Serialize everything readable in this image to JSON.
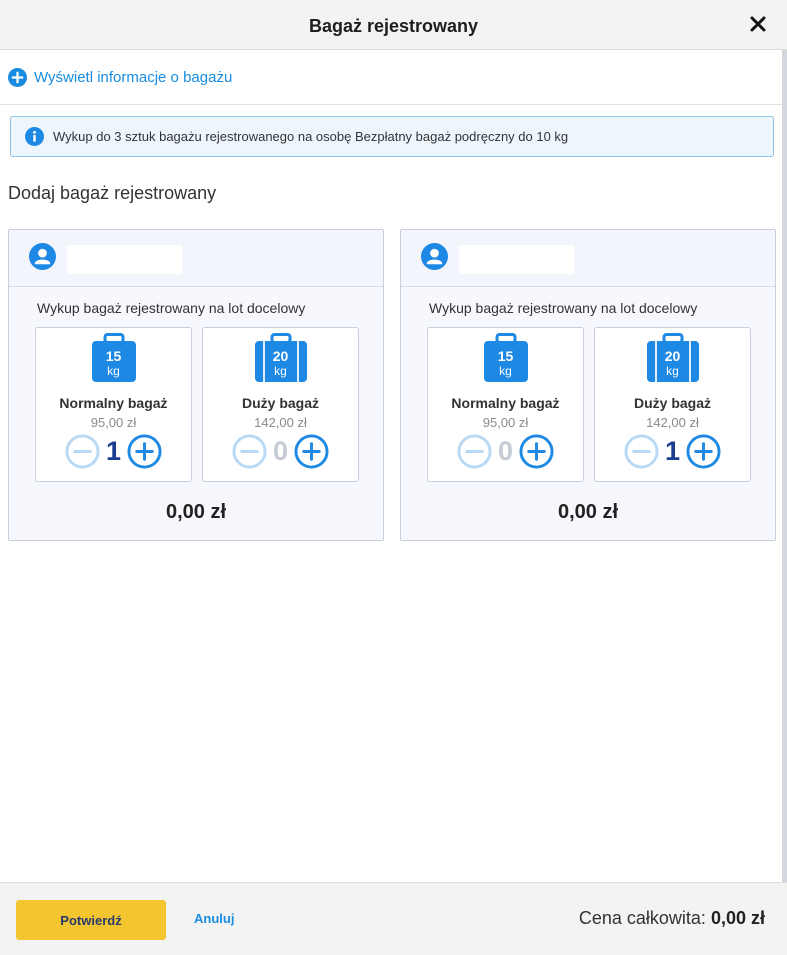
{
  "header": {
    "title": "Bagaż rejestrowany"
  },
  "info_link": {
    "label": "Wyświetl informacje o bagażu"
  },
  "notice": {
    "text": "Wykup do 3 sztuk bagażu rejestrowanego na osobę Bezpłatny bagaż podręczny do 10 kg"
  },
  "section_title": "Dodaj bagaż rejestrowany",
  "passengers": [
    {
      "subtitle": "Wykup bagaż rejestrowany na lot docelowy",
      "bags": [
        {
          "kg": "15",
          "unit": "kg",
          "name": "Normalny bagaż",
          "price": "95,00 zł",
          "qty": "1"
        },
        {
          "kg": "20",
          "unit": "kg",
          "name": "Duży bagaż",
          "price": "142,00 zł",
          "qty": "0"
        }
      ],
      "total": "0,00 zł"
    },
    {
      "subtitle": "Wykup bagaż rejestrowany na lot docelowy",
      "bags": [
        {
          "kg": "15",
          "unit": "kg",
          "name": "Normalny bagaż",
          "price": "95,00 zł",
          "qty": "0"
        },
        {
          "kg": "20",
          "unit": "kg",
          "name": "Duży bagaż",
          "price": "142,00 zł",
          "qty": "1"
        }
      ],
      "total": "0,00 zł"
    }
  ],
  "footer": {
    "confirm_label": "Potwierdź",
    "cancel_label": "Anuluj",
    "total_label": "Cena całkowita:",
    "total_value": "0,00 zł"
  },
  "colors": {
    "accent_blue": "#1a8ce0",
    "icon_blue": "#1e88e5",
    "confirm_yellow": "#f3c62f",
    "qty_active": "#1b3d8f",
    "qty_zero": "#c5ccd6"
  },
  "icons": {
    "close": "close-icon",
    "info_link": "plus-circle-icon",
    "notice": "info-icon",
    "passenger": "user-avatar-icon",
    "bag_normal": "suitcase-icon",
    "bag_large": "large-suitcase-icon",
    "minus": "minus-circle-icon",
    "plus": "plus-circle-icon"
  }
}
